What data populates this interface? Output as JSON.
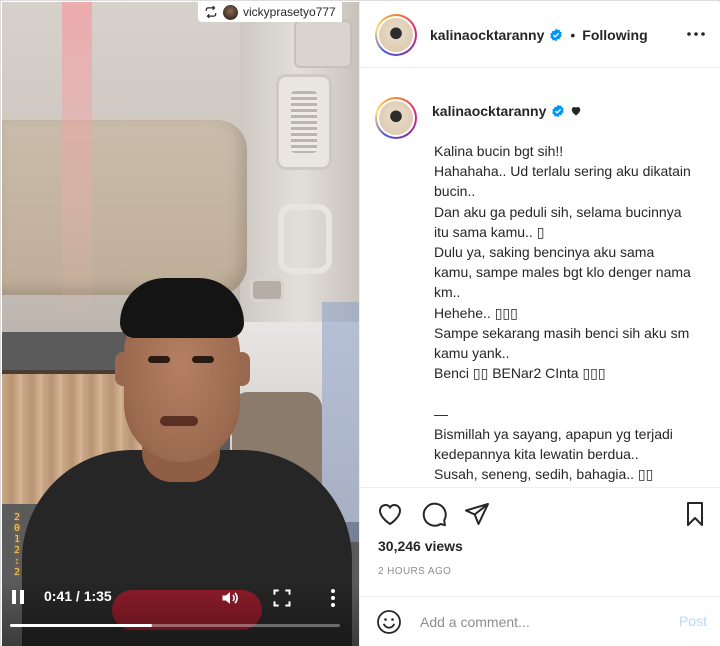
{
  "video": {
    "reposted_from": "vickyprasetyo777",
    "time_label": "0:41 / 1:35",
    "progress": 0.43,
    "date_stamp": "2\n0\n1\n2\n:\n2"
  },
  "header": {
    "username": "kalinaocktaranny",
    "separator": "•",
    "follow_status": "Following"
  },
  "post": {
    "username": "kalinaocktaranny",
    "caption": "Kalina bucin bgt sih!!\nHahahaha.. Ud terlalu sering aku dikatain bucin..\nDan aku ga peduli sih, selama bucinnya itu sama kamu.. ▯\nDulu ya, saking bencinya aku sama kamu, sampe males bgt klo denger nama km..\nHehehe.. ▯▯▯\nSampe sekarang masih benci sih aku sm kamu yank..\nBenci ▯▯ BENar2 CInta ▯▯▯\n\n—\nBismillah ya sayang, apapun yg terjadi kedepannya kita lewatin berdua..\nSusah, seneng, sedih, bahagia.. ▯▯\nMaaf ngga bisa dampingi kamu di"
  },
  "stats": {
    "views": "30,246 views",
    "time_ago": "2 HOURS AGO"
  },
  "comment_box": {
    "placeholder": "Add a comment...",
    "post_label": "Post"
  },
  "colors": {
    "verified": "#0095f6",
    "post_disabled": "#b3dbff",
    "muted": "#8e8e8e"
  },
  "icons": {
    "like": "heart-outline-icon",
    "comment": "speech-bubble-icon",
    "share": "paper-plane-icon",
    "save": "bookmark-icon",
    "emoji": "smiley-icon"
  }
}
